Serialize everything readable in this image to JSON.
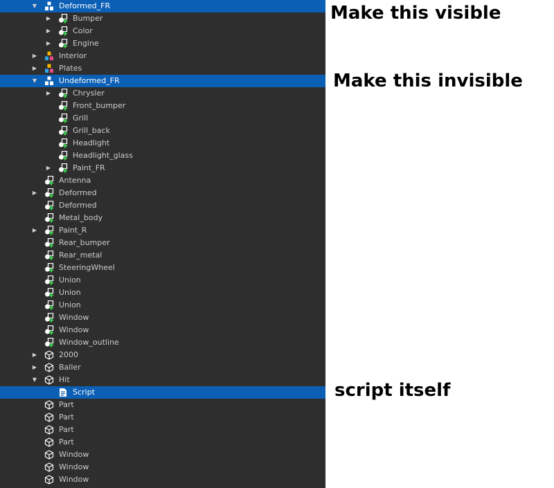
{
  "explorer": {
    "rows": [
      {
        "name": "Deformed_FR",
        "depth": 1,
        "arrow": "down",
        "icon": "model-icon",
        "selected": true
      },
      {
        "name": "Bumper",
        "depth": 2,
        "arrow": "right",
        "icon": "union-icon"
      },
      {
        "name": "Color",
        "depth": 2,
        "arrow": "right",
        "icon": "union-icon"
      },
      {
        "name": "Engine",
        "depth": 2,
        "arrow": "right",
        "icon": "union-icon"
      },
      {
        "name": "Interior",
        "depth": 1,
        "arrow": "right",
        "icon": "folder-model-icon"
      },
      {
        "name": "Plates",
        "depth": 1,
        "arrow": "right",
        "icon": "folder-model-icon"
      },
      {
        "name": "Undeformed_FR",
        "depth": 1,
        "arrow": "down",
        "icon": "model-icon",
        "selected": true
      },
      {
        "name": "Chrysler",
        "depth": 2,
        "arrow": "right",
        "icon": "union-icon"
      },
      {
        "name": "Front_bumper",
        "depth": 2,
        "arrow": "none",
        "icon": "union-icon"
      },
      {
        "name": "Grill",
        "depth": 2,
        "arrow": "none",
        "icon": "union-icon"
      },
      {
        "name": "Grill_back",
        "depth": 2,
        "arrow": "none",
        "icon": "union-icon"
      },
      {
        "name": "Headlight",
        "depth": 2,
        "arrow": "none",
        "icon": "union-icon"
      },
      {
        "name": "Headlight_glass",
        "depth": 2,
        "arrow": "none",
        "icon": "union-icon"
      },
      {
        "name": "Paint_FR",
        "depth": 2,
        "arrow": "right",
        "icon": "union-icon"
      },
      {
        "name": "Antenna",
        "depth": 1,
        "arrow": "none",
        "icon": "union-icon"
      },
      {
        "name": "Deformed",
        "depth": 1,
        "arrow": "right",
        "icon": "union-icon"
      },
      {
        "name": "Deformed",
        "depth": 1,
        "arrow": "none",
        "icon": "union-icon"
      },
      {
        "name": "Metal_body",
        "depth": 1,
        "arrow": "none",
        "icon": "union-icon"
      },
      {
        "name": "Paint_R",
        "depth": 1,
        "arrow": "right",
        "icon": "union-icon"
      },
      {
        "name": "Rear_bumper",
        "depth": 1,
        "arrow": "none",
        "icon": "union-icon"
      },
      {
        "name": "Rear_metal",
        "depth": 1,
        "arrow": "none",
        "icon": "union-icon"
      },
      {
        "name": "SteeringWheel",
        "depth": 1,
        "arrow": "none",
        "icon": "union-icon"
      },
      {
        "name": "Union",
        "depth": 1,
        "arrow": "none",
        "icon": "union-icon"
      },
      {
        "name": "Union",
        "depth": 1,
        "arrow": "none",
        "icon": "union-icon"
      },
      {
        "name": "Union",
        "depth": 1,
        "arrow": "none",
        "icon": "union-icon"
      },
      {
        "name": "Window",
        "depth": 1,
        "arrow": "none",
        "icon": "union-icon"
      },
      {
        "name": "Window",
        "depth": 1,
        "arrow": "none",
        "icon": "union-icon"
      },
      {
        "name": "Window_outline",
        "depth": 1,
        "arrow": "none",
        "icon": "union-icon"
      },
      {
        "name": "2000",
        "depth": 1,
        "arrow": "right",
        "icon": "part-icon"
      },
      {
        "name": "Baller",
        "depth": 1,
        "arrow": "right",
        "icon": "part-icon"
      },
      {
        "name": "Hit",
        "depth": 1,
        "arrow": "down",
        "icon": "part-icon"
      },
      {
        "name": "Script",
        "depth": 2,
        "arrow": "none",
        "icon": "script-icon",
        "selected": true
      },
      {
        "name": "Part",
        "depth": 1,
        "arrow": "none",
        "icon": "part-icon"
      },
      {
        "name": "Part",
        "depth": 1,
        "arrow": "none",
        "icon": "part-icon"
      },
      {
        "name": "Part",
        "depth": 1,
        "arrow": "none",
        "icon": "part-icon"
      },
      {
        "name": "Part",
        "depth": 1,
        "arrow": "none",
        "icon": "part-icon"
      },
      {
        "name": "Window",
        "depth": 1,
        "arrow": "none",
        "icon": "part-icon"
      },
      {
        "name": "Window",
        "depth": 1,
        "arrow": "none",
        "icon": "part-icon"
      },
      {
        "name": "Window",
        "depth": 1,
        "arrow": "none",
        "icon": "part-icon"
      }
    ]
  },
  "annotations": {
    "visible_note": "Make this visible",
    "invisible_note": "Make this invisible",
    "script_note": "script itself"
  },
  "colors": {
    "panel_bg": "#2e2e2e",
    "selection": "#0b5fb5",
    "text": "#cccccc"
  }
}
